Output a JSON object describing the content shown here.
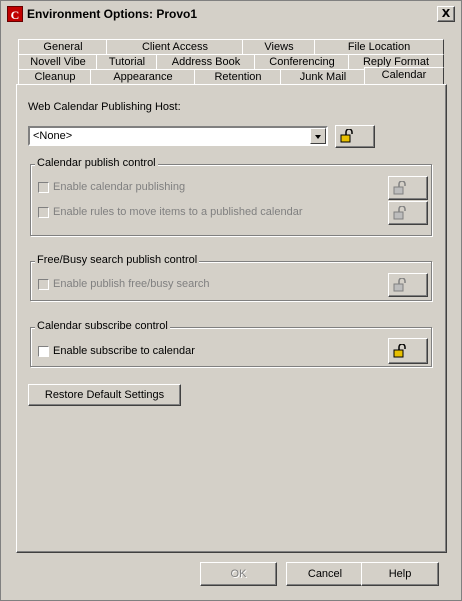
{
  "window": {
    "title": "Environment Options:  Provo1",
    "app_icon": "C",
    "close_label": "X"
  },
  "tabs": {
    "row1": [
      "General",
      "Client Access",
      "Views",
      "File Location"
    ],
    "row2": [
      "Novell Vibe",
      "Tutorial",
      "Address Book",
      "Conferencing",
      "Reply Format"
    ],
    "row3": [
      "Cleanup",
      "Appearance",
      "Retention",
      "Junk Mail",
      "Calendar"
    ],
    "active": "Calendar"
  },
  "host": {
    "label": "Web Calendar Publishing Host:",
    "value": "<None>"
  },
  "groups": {
    "publish": {
      "title": "Calendar publish control",
      "items": [
        "Enable calendar publishing",
        "Enable rules to move items to a published calendar"
      ]
    },
    "freebusy": {
      "title": "Free/Busy search publish control",
      "items": [
        "Enable publish free/busy search"
      ]
    },
    "subscribe": {
      "title": "Calendar subscribe control",
      "items": [
        "Enable subscribe to calendar"
      ]
    }
  },
  "restore_label": "Restore Default Settings",
  "footer": {
    "ok": "OK",
    "cancel": "Cancel",
    "help": "Help"
  },
  "icons": {
    "lock": "lock-icon",
    "app": "groupwise-icon",
    "close": "close-icon",
    "dropdown": "chevron-down-icon"
  }
}
